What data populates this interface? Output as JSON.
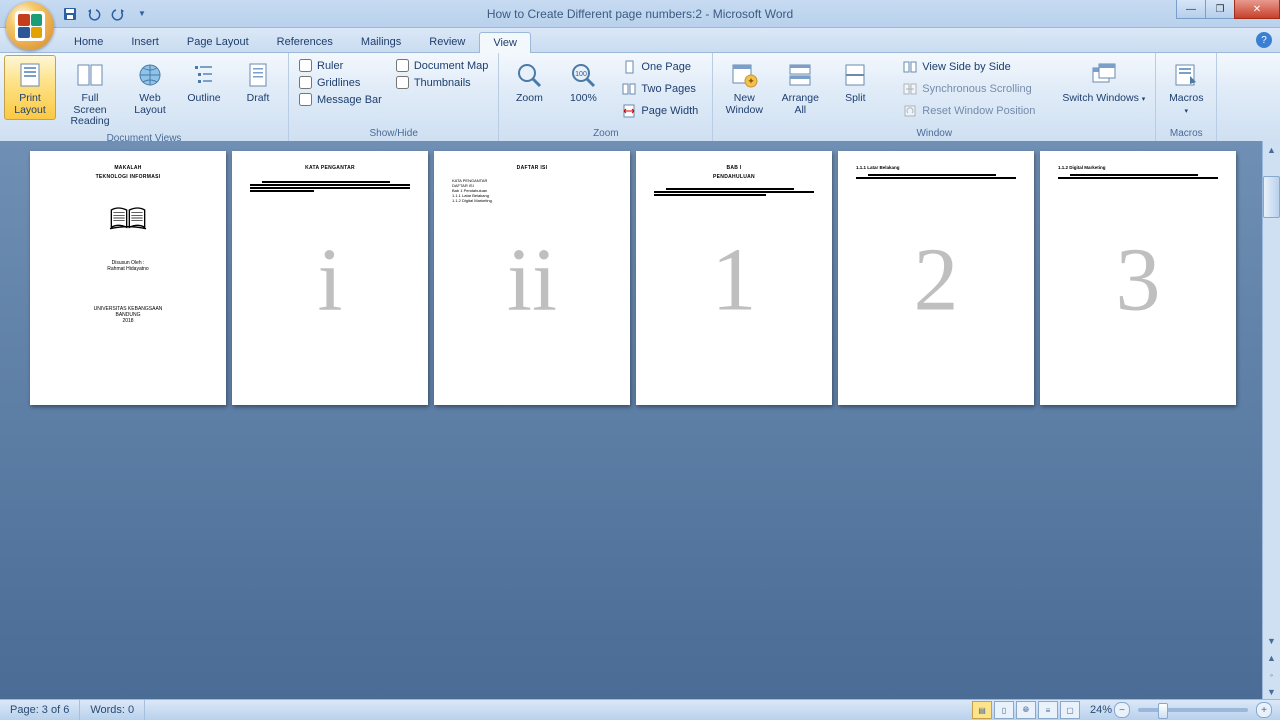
{
  "window": {
    "title": "How to Create Different page numbers:2 - Microsoft Word",
    "min_tip": "Minimize",
    "max_tip": "Restore Down",
    "close_tip": "Close"
  },
  "qat": {
    "save": "Save",
    "undo": "Undo",
    "redo": "Redo",
    "customize": "Customize Quick Access Toolbar"
  },
  "tabs": [
    "Home",
    "Insert",
    "Page Layout",
    "References",
    "Mailings",
    "Review",
    "View"
  ],
  "active_tab": "View",
  "ribbon": {
    "document_views": {
      "label": "Document Views",
      "print_layout": "Print Layout",
      "full_screen": "Full Screen Reading",
      "web_layout": "Web Layout",
      "outline": "Outline",
      "draft": "Draft"
    },
    "show_hide": {
      "label": "Show/Hide",
      "ruler": "Ruler",
      "gridlines": "Gridlines",
      "message_bar": "Message Bar",
      "doc_map": "Document Map",
      "thumbnails": "Thumbnails"
    },
    "zoom": {
      "label": "Zoom",
      "zoom": "Zoom",
      "hundred": "100%",
      "one_page": "One Page",
      "two_pages": "Two Pages",
      "page_width": "Page Width"
    },
    "window_group": {
      "label": "Window",
      "new_window": "New Window",
      "arrange_all": "Arrange All",
      "split": "Split",
      "side_by_side": "View Side by Side",
      "sync_scroll": "Synchronous Scrolling",
      "reset_pos": "Reset Window Position",
      "switch": "Switch Windows"
    },
    "macros": {
      "label": "Macros",
      "macros": "Macros"
    }
  },
  "pages": {
    "p1": {
      "title1": "MAKALAH",
      "title2": "TEKNOLOGI INFORMASI",
      "author1": "Disusun Oleh :",
      "author2": "Rahmat Hidayatno",
      "uni1": "UNIVERSITAS KEBANGSAAN",
      "uni2": "BANDUNG",
      "year": "2018"
    },
    "p2": {
      "title": "KATA PENGANTAR",
      "watermark": "i"
    },
    "p3": {
      "title": "DAFTAR ISI",
      "i1": "KATA PENGANTAR",
      "i2": "DAFTAR ISI",
      "i3": "Bab 1   Pendahuluan",
      "i4": "   1.1.1  Latar Belakang",
      "i5": "   1.1.2  Digital Marketing",
      "watermark": "ii"
    },
    "p4": {
      "title1": "BAB I",
      "title2": "PENDAHULUAN",
      "watermark": "1"
    },
    "p5": {
      "title": "1.1.1   Latar Belakang",
      "watermark": "2"
    },
    "p6": {
      "title": "1.1.2   Digital Marketing",
      "watermark": "3"
    }
  },
  "status": {
    "page": "Page: 3 of 6",
    "words": "Words: 0",
    "zoom": "24%"
  }
}
